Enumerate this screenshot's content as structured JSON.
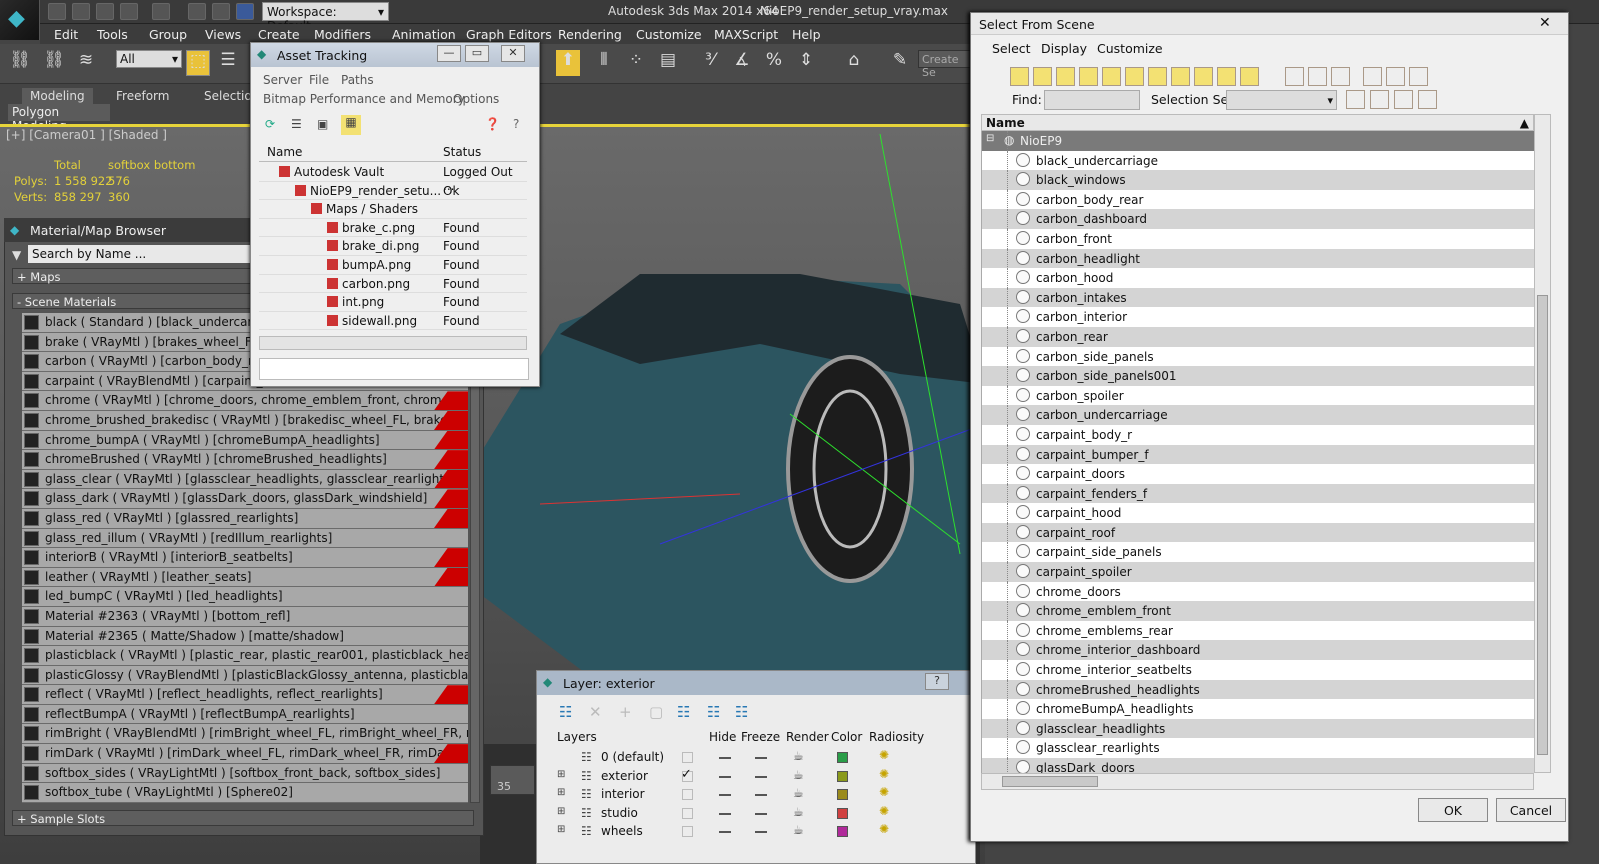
{
  "app": {
    "title": "Autodesk 3ds Max  2014 x64",
    "file": "NioEP9_render_setup_vray.max",
    "workspace": "Workspace: Default"
  },
  "menu": [
    "Edit",
    "Tools",
    "Group",
    "Views",
    "Create",
    "Modifiers",
    "Animation",
    "Graph Editors",
    "Rendering",
    "Customize",
    "MAXScript",
    "Help"
  ],
  "toolbar": {
    "filter": "All",
    "create_selection": "Create Se"
  },
  "ribbon": {
    "tabs": [
      "Modeling",
      "Freeform",
      "Selection"
    ],
    "sub": "Polygon Modeling"
  },
  "viewport": {
    "label": "[+] [Camera01 ] [Shaded ]",
    "stats": {
      "total": "Total",
      "sel": "softbox bottom",
      "polys_label": "Polys:",
      "polys": "1 558 922",
      "polys_sel": "576",
      "verts_label": "Verts:",
      "verts": "858 297",
      "verts_sel": "360"
    },
    "timeline": "35"
  },
  "material_browser": {
    "title": "Material/Map Browser",
    "search": "Search by Name ...",
    "maps": "+ Maps",
    "scene": "- Scene Materials",
    "sample": "+ Sample Slots",
    "rows": [
      {
        "t": "black  ( Standard )  [black_undercarriage",
        "f": false
      },
      {
        "t": "brake  ( VRayMtl )  [brakes_wheel_FL, br",
        "f": false
      },
      {
        "t": "carbon  ( VRayMtl )  [carbon_body_rear, ca",
        "f": false
      },
      {
        "t": "carpaint  ( VRayBlendMtl )  [carpaint_bod",
        "f": false
      },
      {
        "t": "chrome  ( VRayMtl )  [chrome_doors, chrome_emblem_front, chrome_emblems_re",
        "f": true
      },
      {
        "t": "chrome_brushed_brakedisc  ( VRayMtl )  [brakedisc_wheel_FL, brakedisc_wheel_F",
        "f": true
      },
      {
        "t": "chrome_bumpA  ( VRayMtl )  [chromeBumpA_headlights]",
        "f": true
      },
      {
        "t": "chromeBrushed  ( VRayMtl )  [chromeBrushed_headlights]",
        "f": true
      },
      {
        "t": "glass_clear  ( VRayMtl )  [glassclear_headlights, glassclear_rearlights]",
        "f": true
      },
      {
        "t": "glass_dark  ( VRayMtl )  [glassDark_doors, glassDark_windshield]",
        "f": true
      },
      {
        "t": "glass_red  ( VRayMtl )  [glassred_rearlights]",
        "f": true
      },
      {
        "t": "glass_red_illum  ( VRayMtl )  [redIllum_rearlights]",
        "f": false
      },
      {
        "t": "interiorB  ( VRayMtl )  [interiorB_seatbelts]",
        "f": true
      },
      {
        "t": "leather  ( VRayMtl )  [leather_seats]",
        "f": true
      },
      {
        "t": "led_bumpC  ( VRayMtl )  [led_headlights]",
        "f": false
      },
      {
        "t": "Material #2363  ( VRayMtl )  [bottom_refl]",
        "f": false
      },
      {
        "t": "Material #2365  ( Matte/Shadow )  [matte/shadow]",
        "f": false
      },
      {
        "t": "plasticblack  ( VRayMtl )  [plastic_rear, plastic_rear001, plasticblack_headlights, pla",
        "f": false
      },
      {
        "t": "plasticGlossy  ( VRayBlendMtl )  [plasticBlackGlossy_antenna, plasticblackglossy_w",
        "f": false
      },
      {
        "t": "reflect  ( VRayMtl )  [reflect_headlights, reflect_rearlights]",
        "f": true
      },
      {
        "t": "reflectBumpA  ( VRayMtl )  [reflectBumpA_rearlights]",
        "f": false
      },
      {
        "t": "rimBright  ( VRayBlendMtl )  [rimBright_wheel_FL, rimBright_wheel_FR, rimBright_",
        "f": false
      },
      {
        "t": "rimDark  ( VRayMtl )  [rimDark_wheel_FL, rimDark_wheel_FR, rimDark_wheel_RL",
        "f": true
      },
      {
        "t": "softbox_sides  ( VRayLightMtl )  [softbox_front_back, softbox_sides]",
        "f": false
      },
      {
        "t": "softbox_tube  ( VRayLightMtl )  [Sphere02]",
        "f": false
      }
    ]
  },
  "asset": {
    "title": "Asset Tracking",
    "menu1": [
      "Server",
      "File",
      "Paths"
    ],
    "menu2": [
      "Bitmap Performance and Memory",
      "Options"
    ],
    "col_name": "Name",
    "col_status": "Status",
    "rows": [
      {
        "n": "Autodesk Vault",
        "s": "Logged Out ..."
      },
      {
        "n": "NioEP9_render_setu...",
        "s": "Ok"
      },
      {
        "n": "Maps / Shaders",
        "s": ""
      },
      {
        "n": "brake_c.png",
        "s": "Found"
      },
      {
        "n": "brake_di.png",
        "s": "Found"
      },
      {
        "n": "bumpA.png",
        "s": "Found"
      },
      {
        "n": "carbon.png",
        "s": "Found"
      },
      {
        "n": "int.png",
        "s": "Found"
      },
      {
        "n": "sidewall.png",
        "s": "Found"
      }
    ]
  },
  "layer": {
    "title": "Layer: exterior",
    "cols": [
      "Layers",
      "Hide",
      "Freeze",
      "Render",
      "Color",
      "Radiosity"
    ],
    "rows": [
      {
        "n": "0 (default)",
        "c": "#2a9d48"
      },
      {
        "n": "exterior",
        "c": "#8a9a1c"
      },
      {
        "n": "interior",
        "c": "#9a8a1c"
      },
      {
        "n": "studio",
        "c": "#d04040"
      },
      {
        "n": "wheels",
        "c": "#b02a9a"
      }
    ]
  },
  "scene": {
    "title": "Select From Scene",
    "menu": [
      "Select",
      "Display",
      "Customize"
    ],
    "find": "Find:",
    "selset": "Selection Set:",
    "col": "Name",
    "root": "NioEP9",
    "ok": "OK",
    "cancel": "Cancel",
    "items": [
      "black_undercarriage",
      "black_windows",
      "carbon_body_rear",
      "carbon_dashboard",
      "carbon_front",
      "carbon_headlight",
      "carbon_hood",
      "carbon_intakes",
      "carbon_interior",
      "carbon_rear",
      "carbon_side_panels",
      "carbon_side_panels001",
      "carbon_spoiler",
      "carbon_undercarriage",
      "carpaint_body_r",
      "carpaint_bumper_f",
      "carpaint_doors",
      "carpaint_fenders_f",
      "carpaint_hood",
      "carpaint_roof",
      "carpaint_side_panels",
      "carpaint_spoiler",
      "chrome_doors",
      "chrome_emblem_front",
      "chrome_emblems_rear",
      "chrome_interior_dashboard",
      "chrome_interior_seatbelts",
      "chromeBrushed_headlights",
      "chromeBumpA_headlights",
      "glassclear_headlights",
      "glassclear_rearlights",
      "glassDark_doors"
    ]
  }
}
